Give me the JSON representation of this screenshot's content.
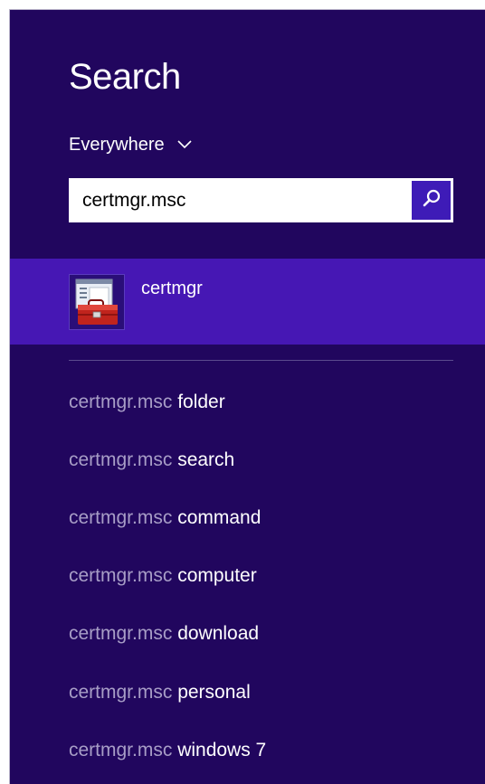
{
  "panel": {
    "title": "Search",
    "scope": "Everywhere",
    "query": "certmgr.msc"
  },
  "colors": {
    "background": "#21065e",
    "selected": "#4617b4",
    "search_button": "#3e1bb7",
    "muted_text": "#a79dc6"
  },
  "result": {
    "name": "certmgr",
    "icon": "toolbox-window-icon"
  },
  "suggestions": [
    {
      "query": "certmgr.msc",
      "term": "folder"
    },
    {
      "query": "certmgr.msc",
      "term": "search"
    },
    {
      "query": "certmgr.msc",
      "term": "command"
    },
    {
      "query": "certmgr.msc",
      "term": "computer"
    },
    {
      "query": "certmgr.msc",
      "term": "download"
    },
    {
      "query": "certmgr.msc",
      "term": "personal"
    },
    {
      "query": "certmgr.msc",
      "term": "windows 7"
    }
  ]
}
